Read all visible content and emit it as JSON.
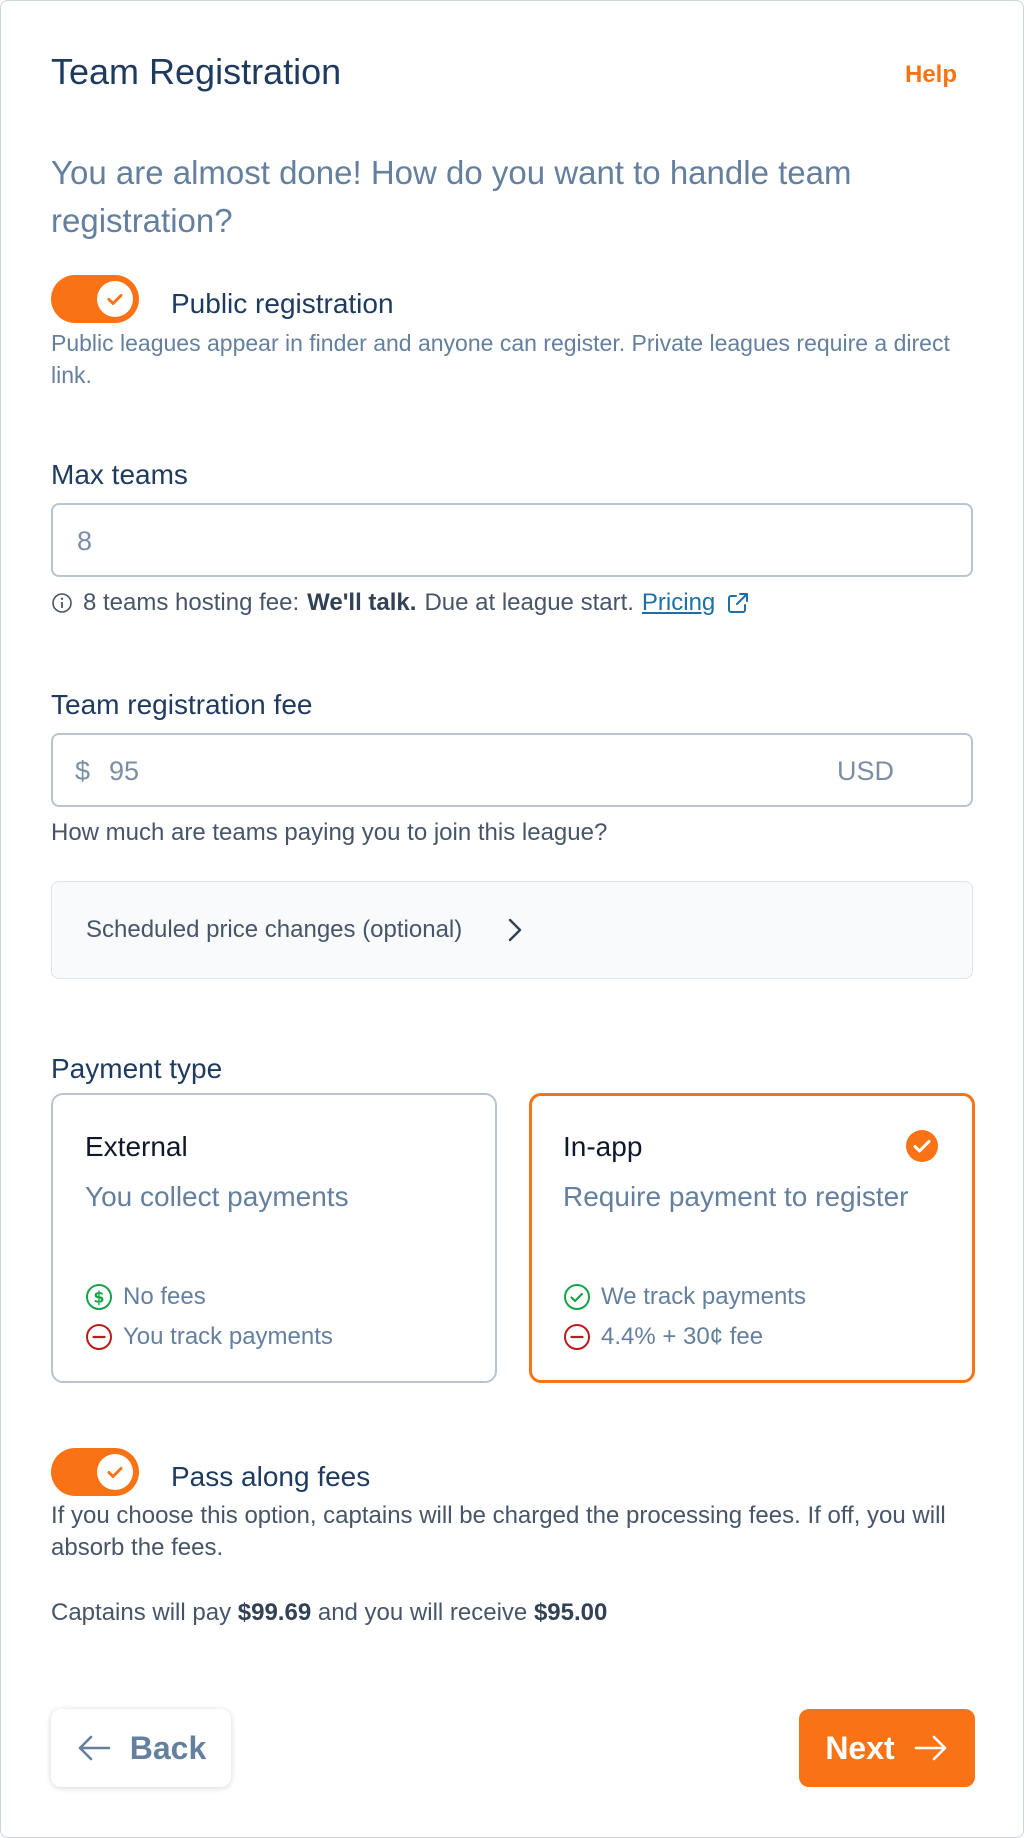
{
  "header": {
    "title": "Team Registration",
    "help_label": "Help"
  },
  "intro": "You are almost done! How do you want to handle team registration?",
  "public_registration": {
    "label": "Public registration",
    "enabled": true,
    "description": "Public leagues appear in finder and anyone can register. Private leagues require a direct link."
  },
  "max_teams": {
    "label": "Max teams",
    "value": "8",
    "note_prefix": "8 teams hosting fee:",
    "note_bold": "We'll talk.",
    "note_suffix": "Due at league start.",
    "pricing_link": "Pricing"
  },
  "registration_fee": {
    "label": "Team registration fee",
    "currency_symbol": "$",
    "value": "95",
    "currency": "USD",
    "helper": "How much are teams paying you to join this league?"
  },
  "scheduled_price_changes": {
    "label": "Scheduled price changes (optional)"
  },
  "payment_type": {
    "label": "Payment type",
    "selected": "In-app",
    "options": [
      {
        "title": "External",
        "subtitle": "You collect payments",
        "features": [
          "No fees",
          "You track payments"
        ]
      },
      {
        "title": "In-app",
        "subtitle": "Require payment to register",
        "features": [
          "We track payments",
          "4.4% + 30¢ fee"
        ]
      }
    ]
  },
  "pass_along_fees": {
    "label": "Pass along fees",
    "enabled": true,
    "description": "If you choose this option, captains will be charged the processing fees. If off, you will absorb the fees.",
    "summary_prefix": "Captains will pay",
    "captain_pays": "$99.69",
    "summary_middle": "and you will receive",
    "you_receive": "$95.00"
  },
  "footer": {
    "back_label": "Back",
    "next_label": "Next"
  },
  "colors": {
    "accent": "#f97316",
    "success": "#16a34a",
    "danger": "#b91c1c"
  }
}
